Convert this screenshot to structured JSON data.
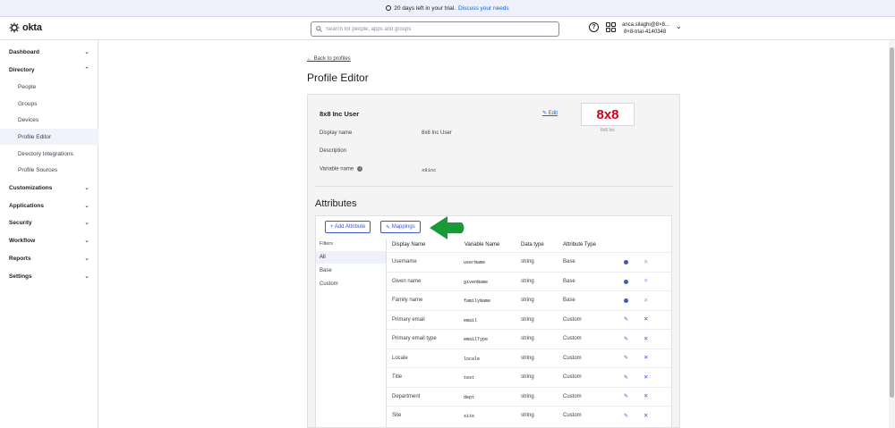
{
  "banner": {
    "text": "20 days left in your trial.",
    "link": "Discuss your needs"
  },
  "header": {
    "logo_text": "okta",
    "search_placeholder": "Search for people, apps and groups",
    "help_label": "?",
    "user_email": "anca.silaghi@8×8...",
    "user_org": "8×8-trial-4140348"
  },
  "sidebar": {
    "items": [
      {
        "label": "Dashboard",
        "caret": "⌄"
      },
      {
        "label": "Directory",
        "caret": "⌃"
      },
      {
        "label": "Customizations",
        "caret": "⌄"
      },
      {
        "label": "Applications",
        "caret": "⌄"
      },
      {
        "label": "Security",
        "caret": "⌄"
      },
      {
        "label": "Workflow",
        "caret": "⌄"
      },
      {
        "label": "Reports",
        "caret": "⌄"
      },
      {
        "label": "Settings",
        "caret": "⌄"
      }
    ],
    "directory_sub": [
      "People",
      "Groups",
      "Devices",
      "Profile Editor",
      "Directory Integrations",
      "Profile Sources"
    ]
  },
  "main": {
    "back_link": "← Back to profiles",
    "title": "Profile Editor",
    "profile": {
      "name": "8x8 Inc User",
      "edit_label": "Edit",
      "logo_text": "8x8",
      "logo_caption": "8x8 Inc",
      "fields": [
        {
          "label": "Display name",
          "value": "8x8 Inc User"
        },
        {
          "label": "Description",
          "value": ""
        },
        {
          "label": "Variable name",
          "value": "x8inc"
        }
      ]
    },
    "attributes": {
      "heading": "Attributes",
      "add_button": "+ Add Attribute",
      "mappings_button": "Mappings",
      "filters_heading": "Filters",
      "filters": [
        "All",
        "Base",
        "Custom"
      ],
      "columns": [
        "Display Name",
        "Variable Name",
        "Data type",
        "Attribute Type"
      ],
      "rows": [
        {
          "display": "Username",
          "variable": "userName",
          "type": "string",
          "attr": "Base"
        },
        {
          "display": "Given name",
          "variable": "givenName",
          "type": "string",
          "attr": "Base"
        },
        {
          "display": "Family name",
          "variable": "familyName",
          "type": "string",
          "attr": "Base"
        },
        {
          "display": "Primary email",
          "variable": "email",
          "type": "string",
          "attr": "Custom"
        },
        {
          "display": "Primary email type",
          "variable": "emailType",
          "type": "string",
          "attr": "Custom"
        },
        {
          "display": "Locale",
          "variable": "locale",
          "type": "string",
          "attr": "Custom"
        },
        {
          "display": "Title",
          "variable": "test",
          "type": "string",
          "attr": "Custom"
        },
        {
          "display": "Department",
          "variable": "dept",
          "type": "string",
          "attr": "Custom"
        },
        {
          "display": "Site",
          "variable": "site",
          "type": "string",
          "attr": "Custom"
        }
      ]
    }
  },
  "colors": {
    "accent": "#3f57c6",
    "link": "#1662dd",
    "arrow": "#1a9a37",
    "brand_logo": "#d0021b"
  }
}
